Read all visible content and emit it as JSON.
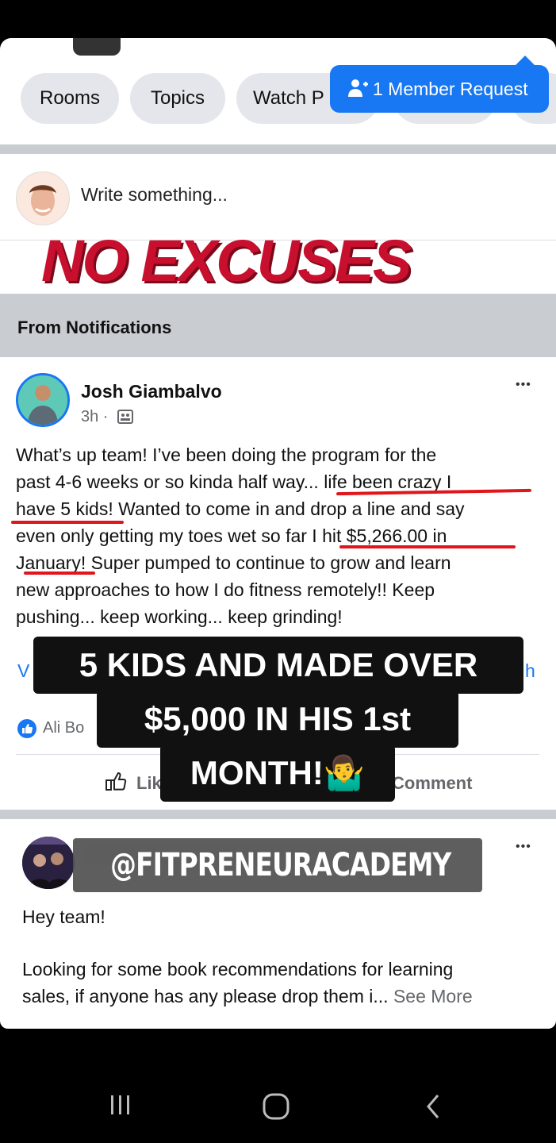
{
  "tabs": [
    "Rooms",
    "Topics",
    "Watch P"
  ],
  "member_request": "1 Member Request",
  "composer": {
    "placeholder": "Write something..."
  },
  "banner": "NO EXCUSES",
  "section": {
    "title": "From Notifications"
  },
  "post1": {
    "author": "Josh Giambalvo",
    "meta": "3h ·",
    "lines": [
      "What’s up team! I’ve been doing the program for the",
      "past 4-6 weeks or so kinda half way... life been crazy I",
      "have 5 kids! Wanted to come in and drop a line and say",
      "even only getting my toes wet so far I hit $5,266.00 in",
      "January! Super pumped to continue to grow and learn",
      "new approaches to how I do fitness remotely!! Keep",
      "pushing... keep working... keep grinding!"
    ],
    "reactions": "Ali Bo",
    "like": "Lik",
    "comment": "Comment",
    "more": "•••"
  },
  "overlay": {
    "line1": "5 KIDS AND MADE OVER",
    "line2": "$5,000 IN HIS 1st",
    "line3": "MONTH!🤷‍♂️"
  },
  "post2": {
    "handle": "@FITPRENEURACADEMY",
    "more": "•••",
    "greeting": "Hey team!",
    "body1": "Looking for some book recommendations for learning",
    "body2": "sales, if anyone has any please drop them i...",
    "see_more": "See More"
  },
  "colors": {
    "accent": "#1877f2",
    "overlay": "#111111",
    "banner": "#c8102e",
    "underline": "#e0161c"
  }
}
